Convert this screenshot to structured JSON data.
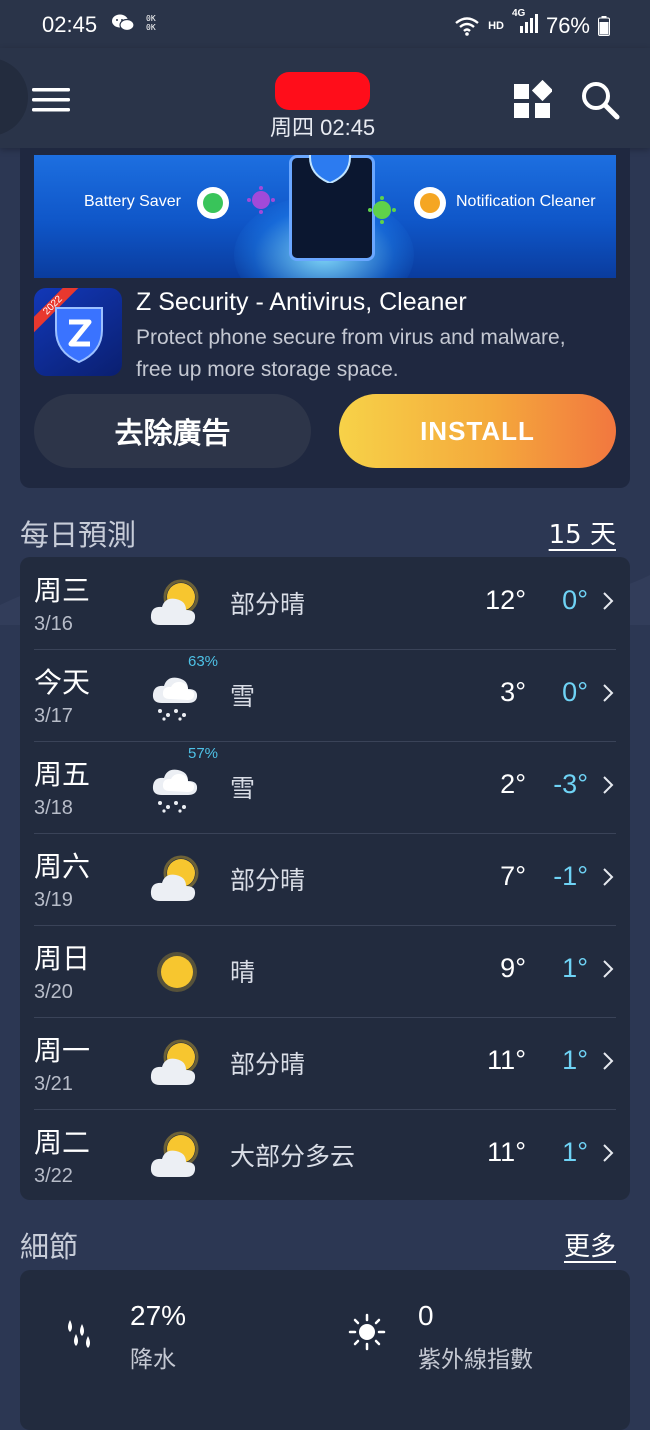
{
  "status_bar": {
    "time": "02:45",
    "ok_badge_line1": "0K",
    "ok_badge_line2": "0K",
    "hd": "HD",
    "network": "4G",
    "battery": "76%"
  },
  "header": {
    "location": "",
    "datetime": "周四 02:45"
  },
  "ad": {
    "banner_left_label": "Battery Saver",
    "banner_right_label": "Notification Cleaner",
    "app_year": "2022",
    "app_title": "Z Security - Antivirus, Cleaner",
    "app_description": "Protect phone secure from virus and malware, free up more storage space.",
    "remove_ads_label": "去除廣告",
    "install_label": "INSTALL"
  },
  "daily": {
    "title": "每日預測",
    "link": "15 天",
    "days": [
      {
        "day": "周三",
        "date": "3/16",
        "icon": "partly-sunny",
        "precip": "",
        "condition": "部分晴",
        "high": "12°",
        "low": "0°"
      },
      {
        "day": "今天",
        "date": "3/17",
        "icon": "snow",
        "precip": "63%",
        "condition": "雪",
        "high": "3°",
        "low": "0°"
      },
      {
        "day": "周五",
        "date": "3/18",
        "icon": "snow",
        "precip": "57%",
        "condition": "雪",
        "high": "2°",
        "low": "-3°"
      },
      {
        "day": "周六",
        "date": "3/19",
        "icon": "partly-sunny",
        "precip": "",
        "condition": "部分晴",
        "high": "7°",
        "low": "-1°"
      },
      {
        "day": "周日",
        "date": "3/20",
        "icon": "sunny",
        "precip": "",
        "condition": "晴",
        "high": "9°",
        "low": "1°"
      },
      {
        "day": "周一",
        "date": "3/21",
        "icon": "partly-sunny",
        "precip": "",
        "condition": "部分晴",
        "high": "11°",
        "low": "1°"
      },
      {
        "day": "周二",
        "date": "3/22",
        "icon": "partly-sunny",
        "precip": "",
        "condition": "大部分多云",
        "high": "11°",
        "low": "1°"
      }
    ]
  },
  "details": {
    "title": "細節",
    "link": "更多",
    "items": [
      {
        "icon": "rain-drops-icon",
        "value": "27%",
        "label": "降水"
      },
      {
        "icon": "sun-icon",
        "value": "0",
        "label": "紫外線指數"
      }
    ]
  }
}
